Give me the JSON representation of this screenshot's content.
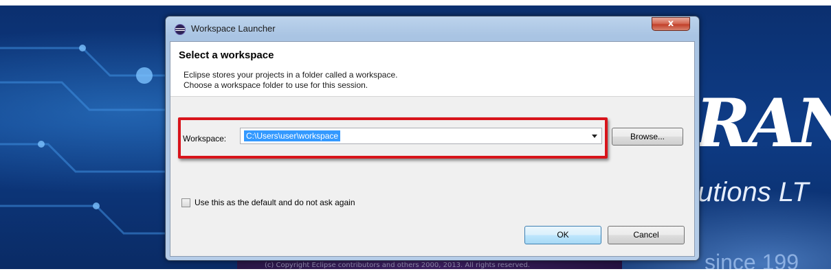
{
  "window": {
    "title": "Workspace Launcher",
    "close_glyph": "x",
    "app_icon": "eclipse-icon"
  },
  "header": {
    "title": "Select a workspace",
    "description_line1": "Eclipse stores your projects in a folder called a workspace.",
    "description_line2": "Choose a workspace folder to use for this session."
  },
  "workspace": {
    "label": "Workspace:",
    "value": "C:\\Users\\user\\workspace",
    "browse_label": "Browse..."
  },
  "default_option": {
    "label": "Use this as the default and do not ask again",
    "checked": false
  },
  "buttons": {
    "ok_label": "OK",
    "cancel_label": "Cancel"
  },
  "background": {
    "brand_text": "RAN",
    "brand_subtitle": "utions LT",
    "brand_since": "since 199",
    "splash_text": "(c) Copyright Eclipse contributors and others 2000, 2013. All rights reserved."
  },
  "colors": {
    "highlight": "#d8141b",
    "selection": "#3399ff",
    "titlebar": "#bcd3ec"
  }
}
